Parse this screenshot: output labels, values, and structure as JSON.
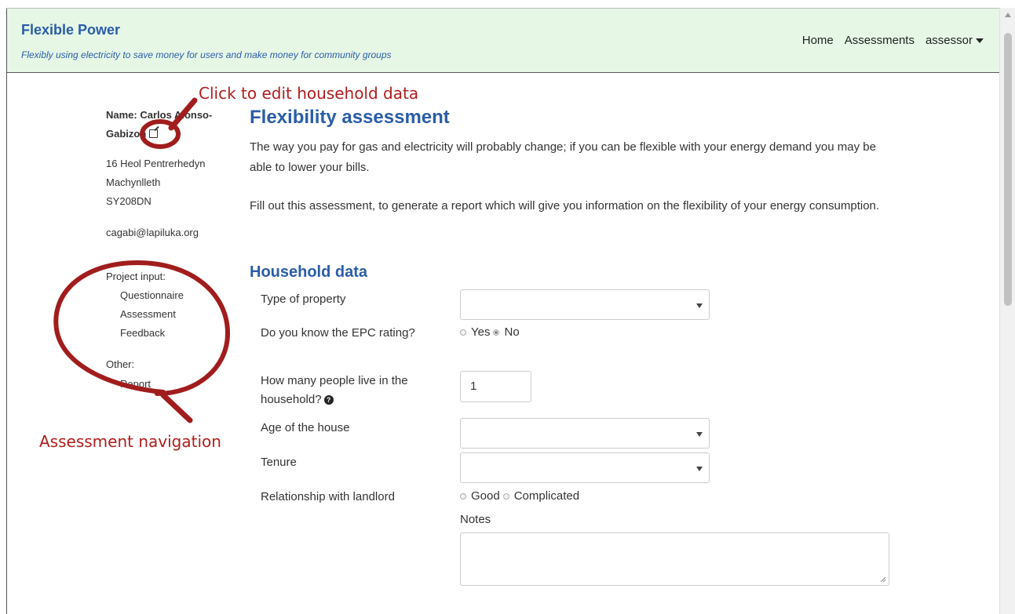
{
  "navbar": {
    "brand": "Flexible Power",
    "tagline": "Flexibly using electricity to save money for users and make money for community groups",
    "links": {
      "home": "Home",
      "assessments": "Assessments",
      "user": "assessor"
    }
  },
  "sidebar": {
    "name": "Name: Carlos Alonso-Gabizon",
    "address": [
      "16 Heol Pentrerhedyn",
      "Machynlleth",
      "SY208DN"
    ],
    "email": "cagabi@lapiluka.org",
    "project_input_label": "Project input:",
    "project_items": [
      "Questionnaire",
      "Assessment",
      "Feedback"
    ],
    "other_label": "Other:",
    "other_items": [
      "Report"
    ]
  },
  "annotations": {
    "edit_hint": "Click to edit household data",
    "nav_hint": "Assessment navigation",
    "color": "#b01d1d"
  },
  "main": {
    "title": "Flexibility assessment",
    "intro1": "The way you pay for gas and electricity will probably change; if you can be flexible with your energy demand you may be able to lower your bills.",
    "intro2": "Fill out this assessment, to generate a report which will give you information on the flexibility of your energy consumption.",
    "section": "Household data",
    "fields": {
      "property_type": {
        "label": "Type of property",
        "value": ""
      },
      "epc": {
        "label": "Do you know the EPC rating?",
        "options": [
          "Yes",
          "No"
        ],
        "selected": "No"
      },
      "people": {
        "label": "How many people live in the household?",
        "value": "1"
      },
      "age": {
        "label": "Age of the house",
        "value": ""
      },
      "tenure": {
        "label": "Tenure",
        "value": ""
      },
      "landlord": {
        "label": "Relationship with landlord",
        "options": [
          "Good",
          "Complicated"
        ],
        "selected": ""
      },
      "notes": {
        "label": "Notes",
        "value": ""
      }
    }
  },
  "colors": {
    "brand": "#2a5da8",
    "navbar_bg": "#e6f7e6"
  }
}
